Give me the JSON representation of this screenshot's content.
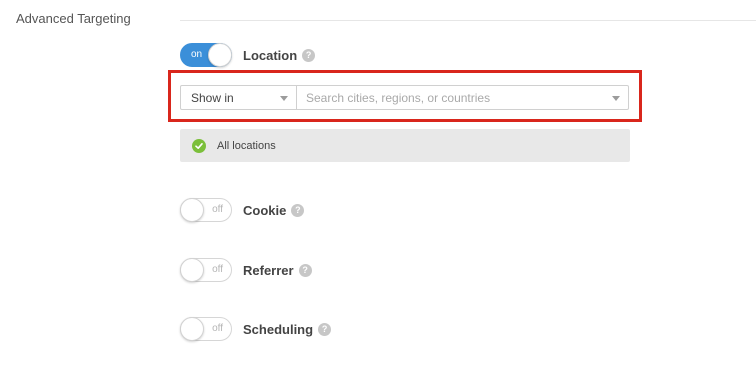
{
  "section": {
    "title": "Advanced Targeting"
  },
  "location": {
    "toggle_state": "on",
    "label": "Location",
    "help_icon": "question-mark-icon",
    "show_in": {
      "selected": "Show in"
    },
    "search": {
      "placeholder": "Search cities, regions, or countries"
    },
    "status": {
      "icon": "check-circle-icon",
      "text": "All locations"
    }
  },
  "cookie": {
    "toggle_state": "off",
    "label": "Cookie",
    "help_icon": "question-mark-icon"
  },
  "referrer": {
    "toggle_state": "off",
    "label": "Referrer",
    "help_icon": "question-mark-icon"
  },
  "scheduling": {
    "toggle_state": "off",
    "label": "Scheduling",
    "help_icon": "question-mark-icon"
  },
  "help_glyph": "?",
  "colors": {
    "toggle_on": "#3b8fd9",
    "highlight_border": "#d9261c",
    "check_green": "#7bbf3a",
    "info_bar_bg": "#e8e8e8"
  }
}
